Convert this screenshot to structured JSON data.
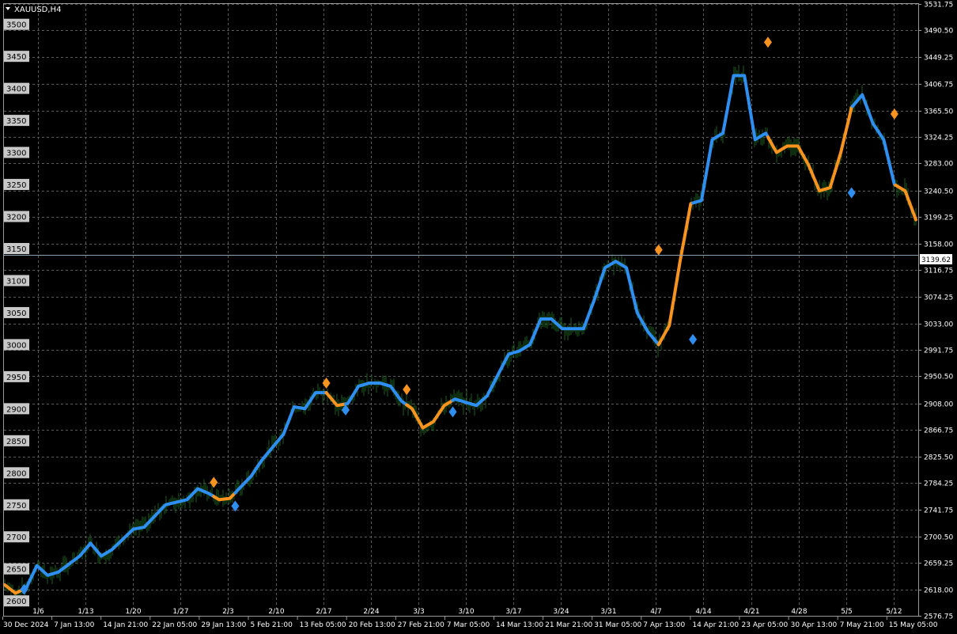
{
  "symbol_label": "XAUUSD,H4",
  "current_price": "3139.62",
  "colors": {
    "background": "#000000",
    "grid": "#5a5a5a",
    "up_trend": "#2f8ff0",
    "down_trend": "#f7931e",
    "candles": "#1e5a1e",
    "bid_line": "#8aa0b0",
    "left_scale_bg": "#c8c8c8"
  },
  "left_scale_labels": [
    "3500",
    "3450",
    "3400",
    "3350",
    "3300",
    "3250",
    "3200",
    "3150",
    "3100",
    "3050",
    "3000",
    "2950",
    "2900",
    "2850",
    "2800",
    "2750",
    "2700",
    "2650",
    "2600"
  ],
  "right_scale_labels": [
    "3531.75",
    "3490.50",
    "3449.25",
    "3406.75",
    "3365.50",
    "3324.25",
    "3283.00",
    "3240.50",
    "3199.25",
    "3158.00",
    "3116.75",
    "3074.25",
    "3033.00",
    "2991.75",
    "2950.50",
    "2908.00",
    "2866.75",
    "2825.50",
    "2784.25",
    "2741.75",
    "2700.50",
    "2659.25",
    "2618.00",
    "2576.75"
  ],
  "time_labels": [
    "30 Dec 2024",
    "7 Jan 13:00",
    "14 Jan 21:00",
    "22 Jan 05:00",
    "29 Jan 13:00",
    "5 Feb 21:00",
    "13 Feb 05:00",
    "20 Feb 13:00",
    "27 Feb 21:00",
    "7 Mar 05:00",
    "14 Mar 13:00",
    "21 Mar 21:00",
    "31 Mar 05:00",
    "7 Apr 13:00",
    "14 Apr 21:00",
    "23 Apr 05:00",
    "30 Apr 13:00",
    "7 May 21:00",
    "15 May 05:00"
  ],
  "week_labels": [
    "1/6",
    "1/13",
    "1/20",
    "1/27",
    "2/3",
    "2/10",
    "2/17",
    "2/24",
    "3/3",
    "3/10",
    "3/17",
    "3/24",
    "3/31",
    "4/7",
    "4/14",
    "4/21",
    "4/28",
    "5/5",
    "5/12"
  ],
  "chart_data": {
    "type": "line",
    "xlabel": "",
    "ylabel": "",
    "ylim": [
      2576.75,
      3531.75
    ],
    "x_unit": "trading day index from 30 Dec 2024",
    "series": [
      {
        "values": [
          [
            0,
            2625
          ],
          [
            1,
            2612
          ],
          [
            2,
            2620
          ],
          [
            3,
            2655
          ],
          [
            4,
            2640
          ],
          [
            5,
            2645
          ],
          [
            7,
            2670
          ],
          [
            8,
            2690
          ],
          [
            9,
            2670
          ],
          [
            10,
            2680
          ],
          [
            12,
            2712
          ],
          [
            13,
            2715
          ],
          [
            15,
            2750
          ],
          [
            17,
            2758
          ],
          [
            18,
            2775
          ],
          [
            19,
            2768
          ],
          [
            20,
            2758
          ],
          [
            21,
            2760
          ],
          [
            23,
            2795
          ],
          [
            24,
            2820
          ],
          [
            26,
            2860
          ],
          [
            27,
            2903
          ],
          [
            28,
            2900
          ],
          [
            29,
            2925
          ],
          [
            30,
            2925
          ],
          [
            31,
            2905
          ],
          [
            32,
            2908
          ],
          [
            33,
            2935
          ],
          [
            34,
            2940
          ],
          [
            35,
            2940
          ],
          [
            36,
            2935
          ],
          [
            37,
            2912
          ],
          [
            38,
            2900
          ],
          [
            39,
            2870
          ],
          [
            40,
            2880
          ],
          [
            41,
            2905
          ],
          [
            42,
            2915
          ],
          [
            44,
            2905
          ],
          [
            45,
            2920
          ],
          [
            47,
            2985
          ],
          [
            48,
            2990
          ],
          [
            49,
            3000
          ],
          [
            50,
            3040
          ],
          [
            51,
            3040
          ],
          [
            52,
            3025
          ],
          [
            54,
            3025
          ],
          [
            55,
            3070
          ],
          [
            56,
            3120
          ],
          [
            57,
            3130
          ],
          [
            58,
            3120
          ],
          [
            59,
            3050
          ],
          [
            60,
            3020
          ],
          [
            61,
            3000
          ],
          [
            62,
            3030
          ],
          [
            63,
            3130
          ],
          [
            64,
            3220
          ],
          [
            65,
            3225
          ],
          [
            66,
            3320
          ],
          [
            67,
            3330
          ],
          [
            68,
            3420
          ],
          [
            69,
            3420
          ],
          [
            70,
            3320
          ],
          [
            71,
            3330
          ],
          [
            72,
            3300
          ],
          [
            73,
            3310
          ],
          [
            74,
            3310
          ],
          [
            75,
            3280
          ],
          [
            76,
            3240
          ],
          [
            77,
            3245
          ],
          [
            78,
            3300
          ],
          [
            79,
            3370
          ],
          [
            80,
            3390
          ],
          [
            81,
            3345
          ],
          [
            82,
            3320
          ],
          [
            83,
            3250
          ],
          [
            84,
            3240
          ],
          [
            85,
            3195
          ]
        ]
      }
    ],
    "arrows": [
      {
        "x": 1.8,
        "y": 2618,
        "dir": "up"
      },
      {
        "x": 19.5,
        "y": 2785,
        "dir": "down"
      },
      {
        "x": 21.5,
        "y": 2748,
        "dir": "up"
      },
      {
        "x": 30.0,
        "y": 2940,
        "dir": "down"
      },
      {
        "x": 31.8,
        "y": 2898,
        "dir": "up"
      },
      {
        "x": 37.5,
        "y": 2930,
        "dir": "down"
      },
      {
        "x": 41.8,
        "y": 2895,
        "dir": "up"
      },
      {
        "x": 61.0,
        "y": 3148,
        "dir": "down"
      },
      {
        "x": 64.2,
        "y": 3008,
        "dir": "up"
      },
      {
        "x": 71.2,
        "y": 3472,
        "dir": "down"
      },
      {
        "x": 79.0,
        "y": 3237,
        "dir": "up"
      },
      {
        "x": 83.0,
        "y": 3360,
        "dir": "down"
      }
    ]
  }
}
